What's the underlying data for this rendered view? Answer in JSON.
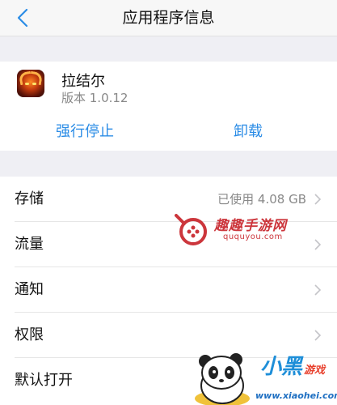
{
  "navbar": {
    "title": "应用程序信息"
  },
  "app": {
    "name": "拉结尔",
    "version": "版本 1.0.12",
    "actions": {
      "force_stop": "强行停止",
      "uninstall": "卸载"
    }
  },
  "settings": {
    "items": [
      {
        "label": "存储",
        "value": "已使用 4.08 GB"
      },
      {
        "label": "流量",
        "value": ""
      },
      {
        "label": "通知",
        "value": ""
      },
      {
        "label": "权限",
        "value": ""
      },
      {
        "label": "默认打开",
        "value": ""
      }
    ]
  },
  "watermarks": {
    "quququyou": {
      "title": "趣趣手游网",
      "url": "ququyou.com"
    },
    "xiaohei": {
      "title": "小黑",
      "subtitle": "游戏",
      "url": "www.xiaohei.com"
    }
  },
  "colors": {
    "accent": "#2b8ce6",
    "background": "#efeff4"
  }
}
